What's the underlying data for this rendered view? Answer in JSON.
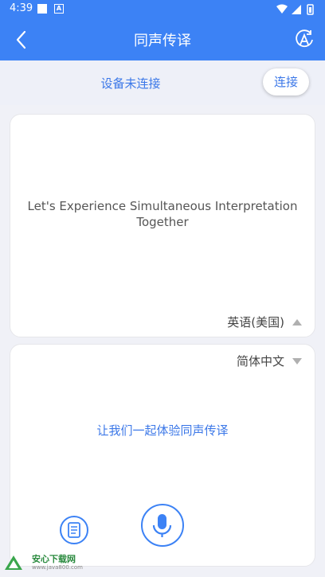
{
  "status_bar": {
    "time": "4:39",
    "notif_letter": "A"
  },
  "header": {
    "title": "同声传译"
  },
  "connection": {
    "status": "设备未连接",
    "connect_label": "连接"
  },
  "source_panel": {
    "text": "Let's Experience Simultaneous Interpretation Together",
    "language": "英语(美国)"
  },
  "target_panel": {
    "language": "简体中文",
    "text": "让我们一起体验同声传译"
  },
  "watermark": {
    "name": "安心下载网",
    "url": "www.java800.com"
  },
  "colors": {
    "primary": "#3c82f5",
    "text_blue": "#3c78e8"
  }
}
